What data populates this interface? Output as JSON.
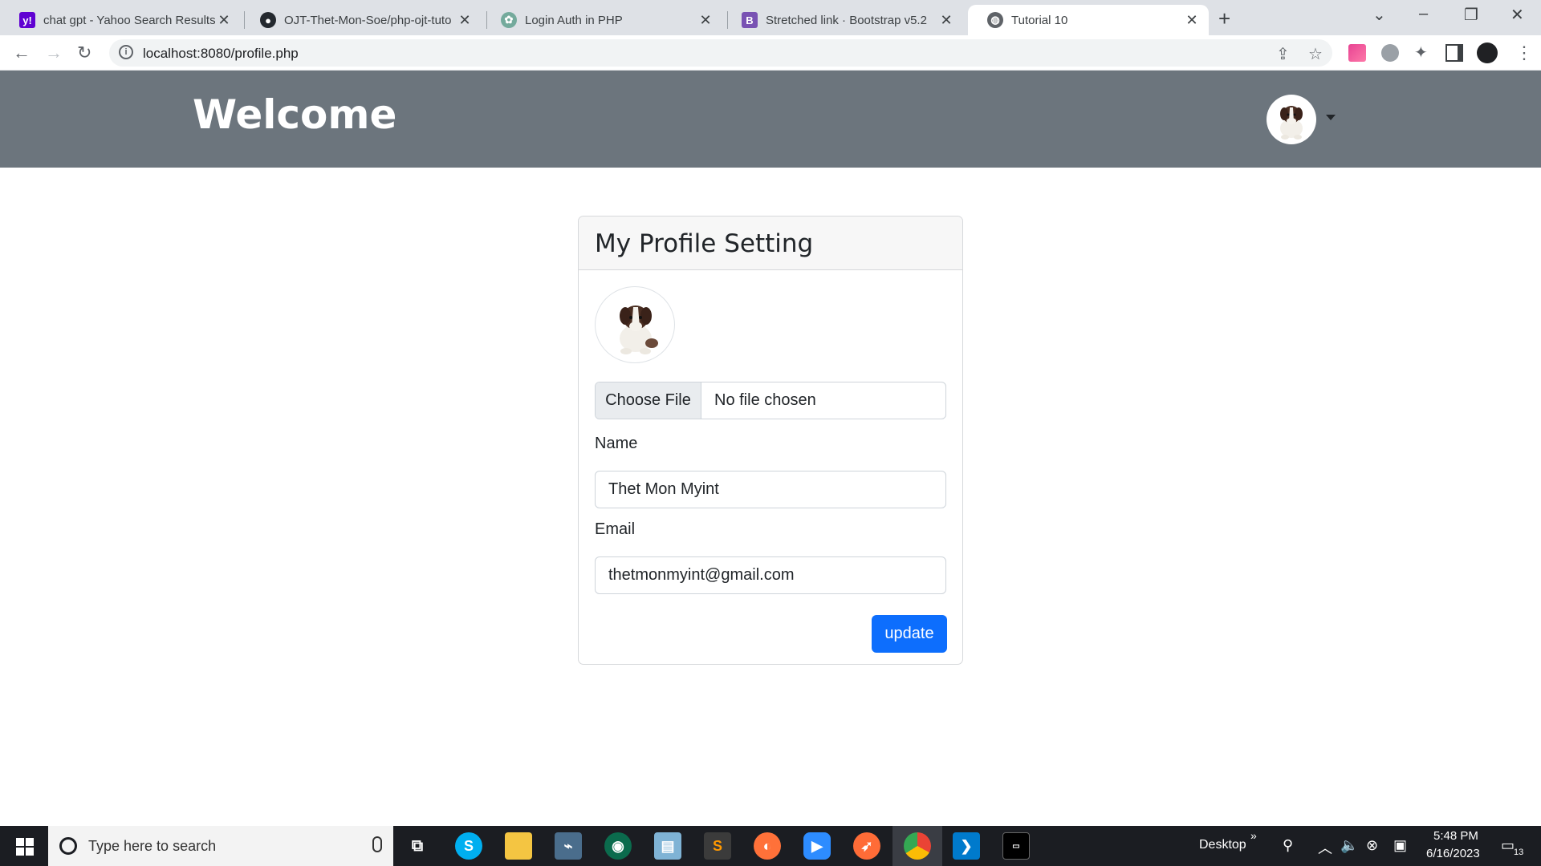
{
  "browser": {
    "tabs": [
      {
        "title": "chat gpt - Yahoo Search Results",
        "icon": "yahoo-icon",
        "color": "#6001d2",
        "glyph": "y!"
      },
      {
        "title": "OJT-Thet-Mon-Soe/php-ojt-tuto",
        "icon": "github-icon",
        "color": "#24292f",
        "glyph": "●"
      },
      {
        "title": "Login Auth in PHP",
        "icon": "chatgpt-icon",
        "color": "#74aa9c",
        "glyph": "✿"
      },
      {
        "title": "Stretched link · Bootstrap v5.2",
        "icon": "bootstrap-icon",
        "color": "#7952b3",
        "glyph": "B"
      },
      {
        "title": "Tutorial 10",
        "icon": "globe-icon",
        "color": "#5f6368",
        "glyph": "◍"
      }
    ],
    "new_tab": "+",
    "url": "localhost:8080/profile.php"
  },
  "navbar": {
    "brand": "Welcome"
  },
  "profile_card": {
    "title": "My Profile Setting",
    "file_button": "Choose File",
    "file_status": "No file chosen",
    "name_label": "Name",
    "name_value": "Thet Mon Myint",
    "email_label": "Email",
    "email_value": "thetmonmyint@gmail.com",
    "update_label": "update"
  },
  "colors": {
    "navbar_bg": "#6c757d",
    "primary": "#0d6efd",
    "taskbar_bg": "#1b1d22"
  },
  "taskbar": {
    "search_placeholder": "Type here to search",
    "desktop_label": "Desktop",
    "time": "5:48 PM",
    "date": "6/16/2023",
    "notification_count": "13"
  }
}
